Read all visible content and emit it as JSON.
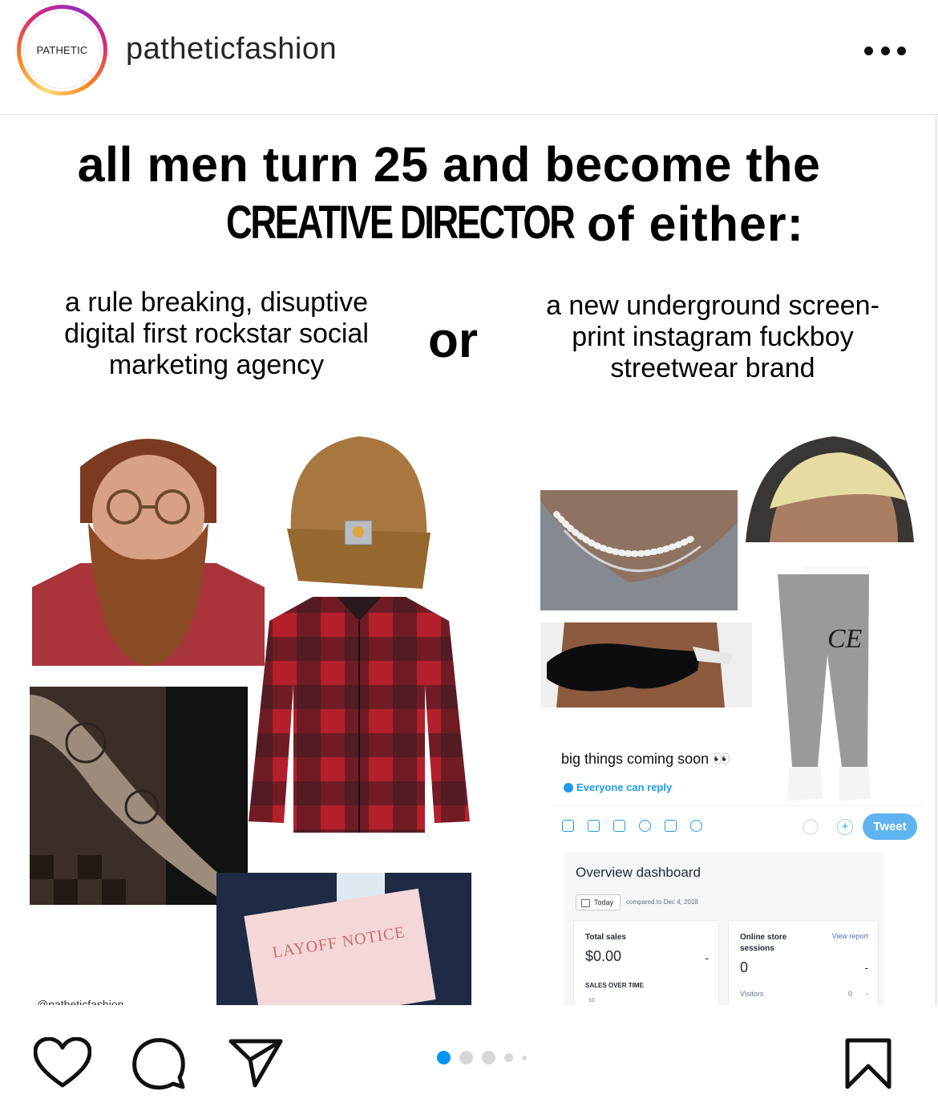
{
  "header": {
    "avatar_text": "PATHETIC",
    "username": "patheticfashion"
  },
  "post": {
    "headline_line1": "all men turn 25 and become the",
    "headline_emph": "CREATIVE DIRECTOR",
    "headline_line2": "of either:",
    "left_option": "a rule breaking, disuptive digital first rockstar social marketing agency",
    "or": "or",
    "right_option": "a new underground screen-print instagram fuckboy streetwear brand",
    "layoff_notice": "LAYOFF NOTICE",
    "watermark": "@patheticfashion",
    "pants_logo": "CE",
    "tweet": {
      "text": "big things coming soon 👀",
      "reply_setting": "Everyone can reply",
      "button": "Tweet",
      "plus": "+"
    },
    "dashboard": {
      "title": "Overview dashboard",
      "date_button": "Today",
      "compared": "compared to Dec 4, 2018",
      "total_sales_label": "Total sales",
      "total_sales_value": "$0.00",
      "total_sales_trend": "-",
      "sales_over_time": "SALES OVER TIME",
      "axis_tick": "10",
      "sessions_label": "Online store sessions",
      "sessions_value": "0",
      "sessions_trend": "-",
      "view_report": "View report",
      "visitors_label": "Visitors",
      "visitors_value": "0",
      "visitors_trend": "-"
    }
  },
  "carousel": {
    "total": 5,
    "active_index": 0
  },
  "colors": {
    "accent_blue": "#0095f6",
    "twitter_blue": "#1d9bf0"
  }
}
